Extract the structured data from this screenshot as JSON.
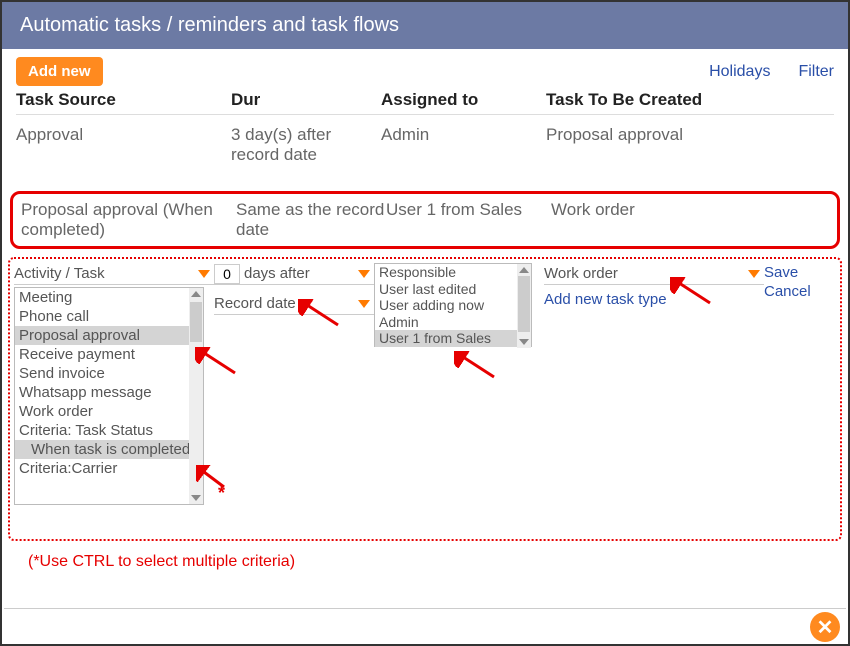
{
  "header": {
    "title": "Automatic tasks / reminders and task flows"
  },
  "toolbar": {
    "add_new": "Add new",
    "holidays": "Holidays",
    "filter": "Filter"
  },
  "columns": {
    "source": "Task Source",
    "dur": "Dur",
    "assigned": "Assigned to",
    "created": "Task To Be Created"
  },
  "rows": [
    {
      "source": "Approval",
      "dur": "3 day(s) after record date",
      "assigned": "Admin",
      "created": "Proposal approval"
    },
    {
      "source": "Proposal approval (When completed)",
      "dur": "Same as the record date",
      "assigned": "User 1 from Sales",
      "created": "Work order"
    }
  ],
  "editor": {
    "activity_label": "Activity / Task",
    "days_value": "0",
    "days_word": "days",
    "after_word": "after",
    "record_date": "Record date",
    "work_order": "Work order",
    "add_type": "Add new task type",
    "save": "Save",
    "cancel": "Cancel",
    "activities": [
      "Meeting",
      "Phone call",
      "Proposal approval",
      "Receive payment",
      "Send invoice",
      "Whatsapp message",
      "Work order",
      "Criteria: Task Status",
      "When task is completed",
      "Criteria:Carrier"
    ],
    "activities_selected": [
      2,
      8
    ],
    "assignees": [
      "Responsible",
      "User last edited",
      "User adding now",
      "Admin",
      "User 1 from Sales"
    ],
    "assignees_selected": 4,
    "ast": "*"
  },
  "hint": "(*Use CTRL to select multiple criteria)"
}
